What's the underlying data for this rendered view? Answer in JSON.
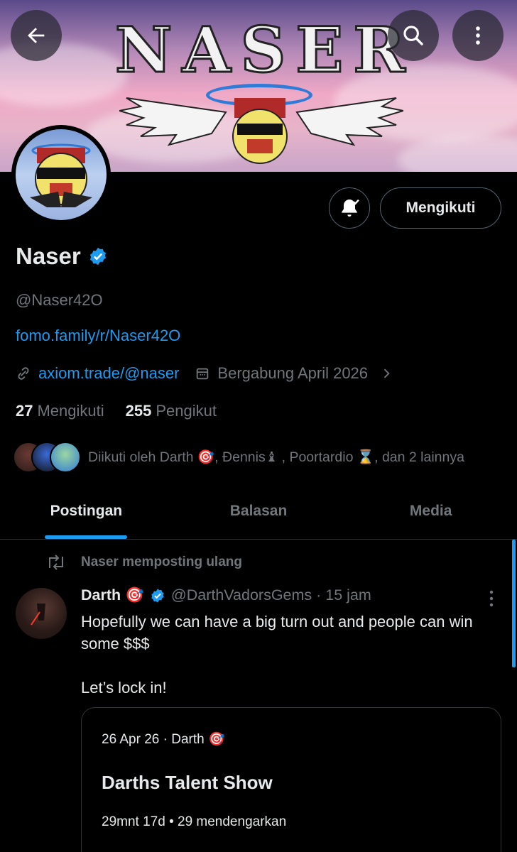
{
  "banner": {
    "title": "NASER"
  },
  "profile": {
    "name": "Naser",
    "handle": "@Naser42O",
    "bio_link": "fomo.family/r/Naser42O",
    "website": "axiom.trade/@naser",
    "joined": "Bergabung April 2026",
    "following_count": "27",
    "following_label": "Mengikuti",
    "followers_count": "255",
    "followers_label": "Pengikut",
    "followed_by": "Diikuti oleh Darth 🎯, Ðennis♝ , Poortardio ⌛, dan 2 lainnya"
  },
  "actions": {
    "follow_label": "Mengikuti"
  },
  "tabs": [
    {
      "label": "Postingan",
      "active": true
    },
    {
      "label": "Balasan",
      "active": false
    },
    {
      "label": "Media",
      "active": false
    }
  ],
  "post": {
    "repost_label": "Naser memposting ulang",
    "author_name": "Darth 🎯",
    "author_handle": "@DarthVadorsGems · 15 jam",
    "body": "Hopefully we can have a big turn out and people can win some $$$\n\nLet’s lock in!",
    "space": {
      "meta": "26 Apr 26 · Darth 🎯",
      "title": "Darths Talent Show",
      "stats": "29mnt 17d • 29 mendengarkan"
    }
  },
  "colors": {
    "accent": "#1d9bf0",
    "muted": "#71767b",
    "text": "#e7e9ea",
    "border": "#2f3336"
  }
}
